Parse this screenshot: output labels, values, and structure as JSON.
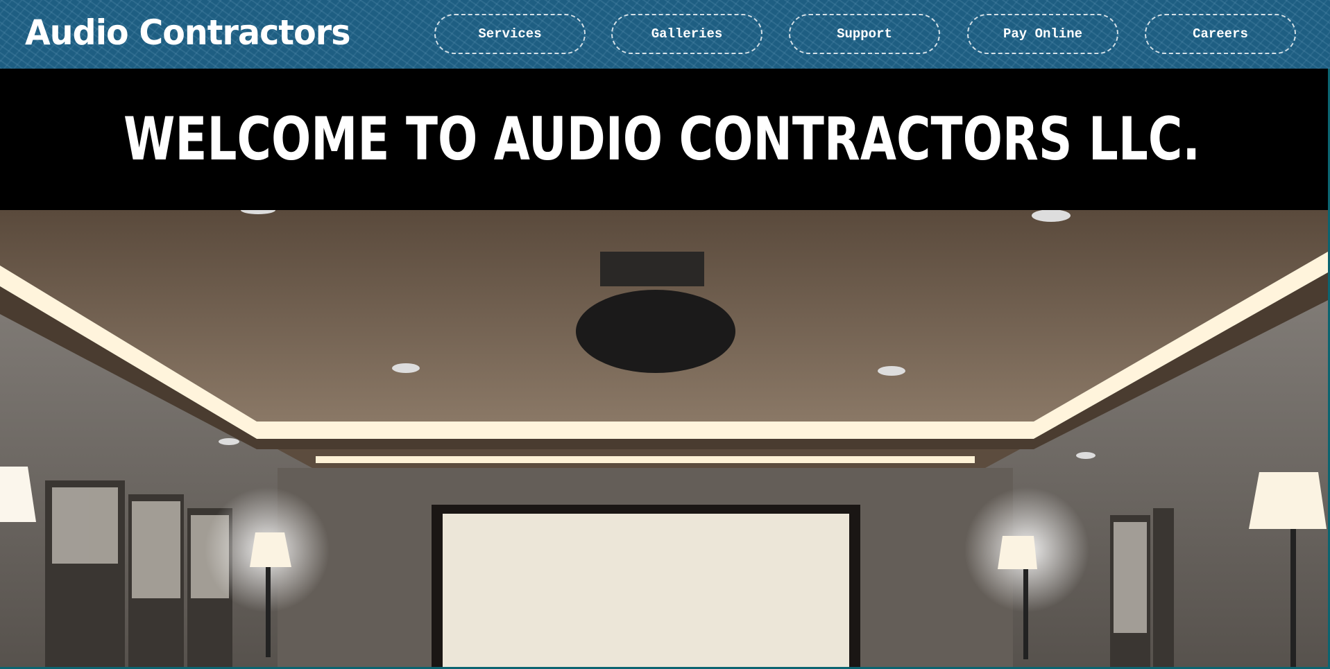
{
  "header": {
    "logo": "Audio Contractors",
    "nav": [
      {
        "label": "Services"
      },
      {
        "label": "Galleries"
      },
      {
        "label": "Support"
      },
      {
        "label": "Pay Online"
      },
      {
        "label": "Careers"
      }
    ]
  },
  "hero": {
    "title": "WELCOME TO AUDIO CONTRACTORS LLC."
  },
  "colors": {
    "header_bg": "#1e5e82",
    "banner_bg": "#000000",
    "frame": "#0b6470"
  }
}
